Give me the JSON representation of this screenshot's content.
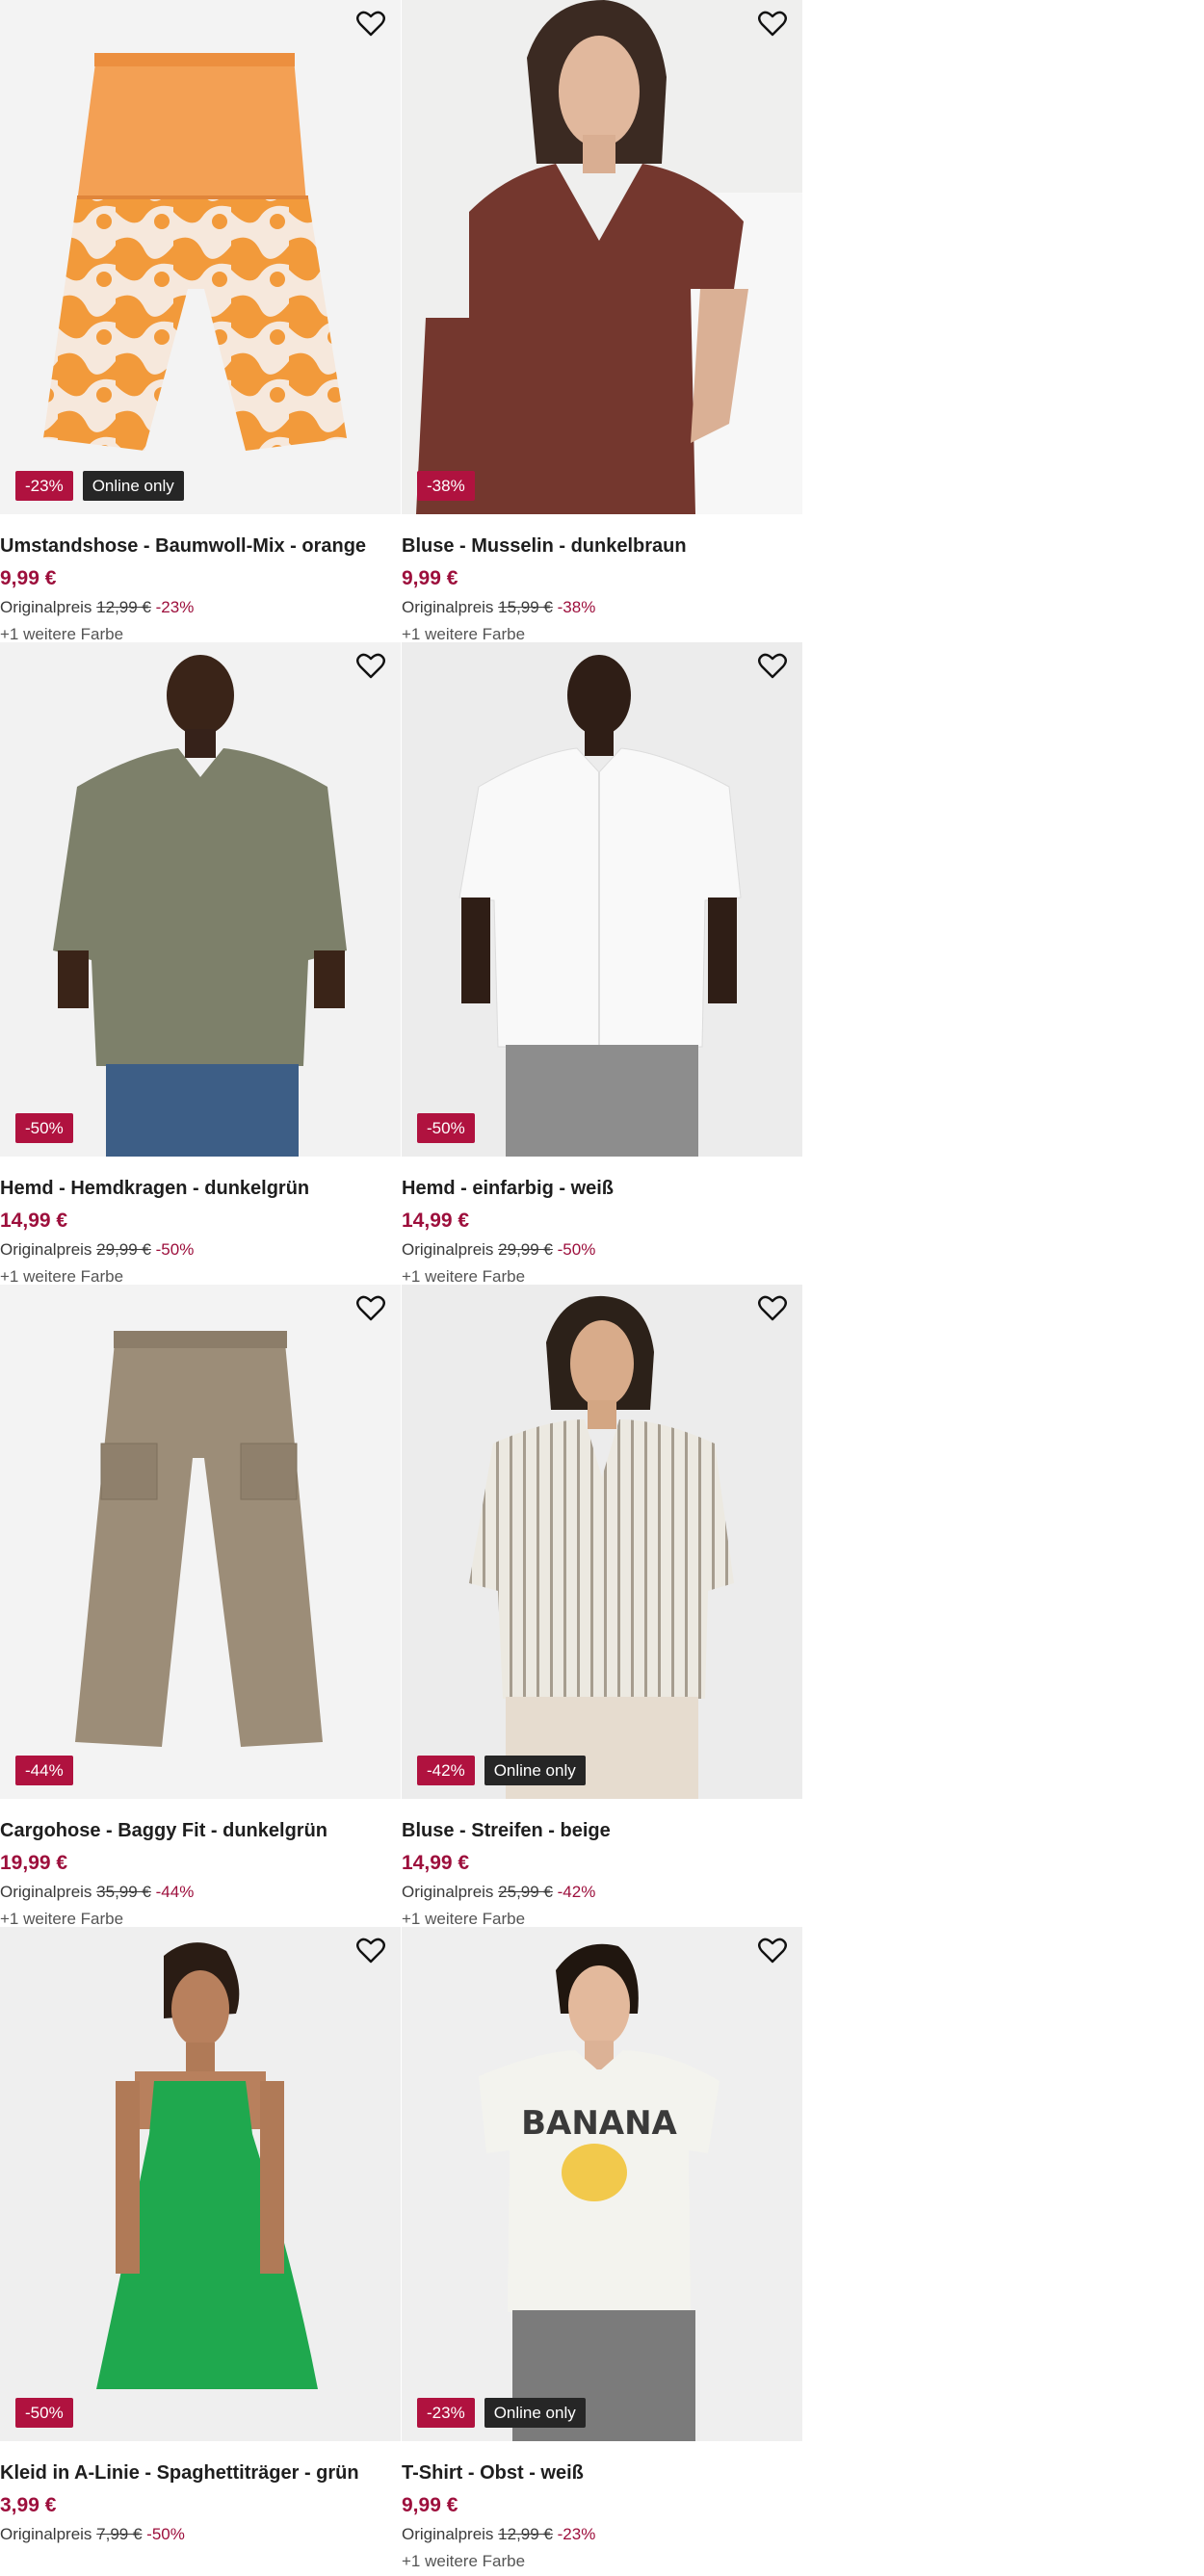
{
  "products": [
    {
      "title": "Umstandshose - Baumwoll-Mix - orange",
      "price": "9,99 €",
      "orig_label": "Originalpreis",
      "orig_price": "12,99 €",
      "discount": "-23%",
      "online": "Online only",
      "colors": "+1 weitere Farbe",
      "icon": "heart-icon",
      "art": "shorts"
    },
    {
      "title": "Bluse - Musselin - dunkelbraun",
      "price": "9,99 €",
      "orig_label": "Originalpreis",
      "orig_price": "15,99 €",
      "discount": "-38%",
      "online": "",
      "colors": "+1 weitere Farbe",
      "icon": "heart-icon",
      "art": "blouse-brown"
    },
    {
      "title": "Hemd - Hemdkragen - dunkelgrün",
      "price": "14,99 €",
      "orig_label": "Originalpreis",
      "orig_price": "29,99 €",
      "discount": "-50%",
      "online": "",
      "colors": "+1 weitere Farbe",
      "icon": "heart-icon",
      "art": "shirt-green"
    },
    {
      "title": "Hemd - einfarbig - weiß",
      "price": "14,99 €",
      "orig_label": "Originalpreis",
      "orig_price": "29,99 €",
      "discount": "-50%",
      "online": "",
      "colors": "+1 weitere Farbe",
      "icon": "heart-icon",
      "art": "shirt-white"
    },
    {
      "title": "Cargohose - Baggy Fit - dunkelgrün",
      "price": "19,99 €",
      "orig_label": "Originalpreis",
      "orig_price": "35,99 €",
      "discount": "-44%",
      "online": "",
      "colors": "+1 weitere Farbe",
      "icon": "heart-icon",
      "art": "cargo"
    },
    {
      "title": "Bluse - Streifen - beige",
      "price": "14,99 €",
      "orig_label": "Originalpreis",
      "orig_price": "25,99 €",
      "discount": "-42%",
      "online": "Online only",
      "colors": "+1 weitere Farbe",
      "icon": "heart-icon",
      "art": "blouse-stripe"
    },
    {
      "title": "Kleid in A-Linie - Spaghettiträger - grün",
      "price": "3,99 €",
      "orig_label": "Originalpreis",
      "orig_price": "7,99 €",
      "discount": "-50%",
      "online": "",
      "colors": "",
      "icon": "heart-icon",
      "art": "dress"
    },
    {
      "title": "T-Shirt - Obst - weiß",
      "price": "9,99 €",
      "orig_label": "Originalpreis",
      "orig_price": "12,99 €",
      "discount": "-23%",
      "online": "Online only",
      "colors": "+1 weitere Farbe",
      "icon": "heart-icon",
      "art": "tshirt",
      "art_text": "BANANA"
    }
  ]
}
